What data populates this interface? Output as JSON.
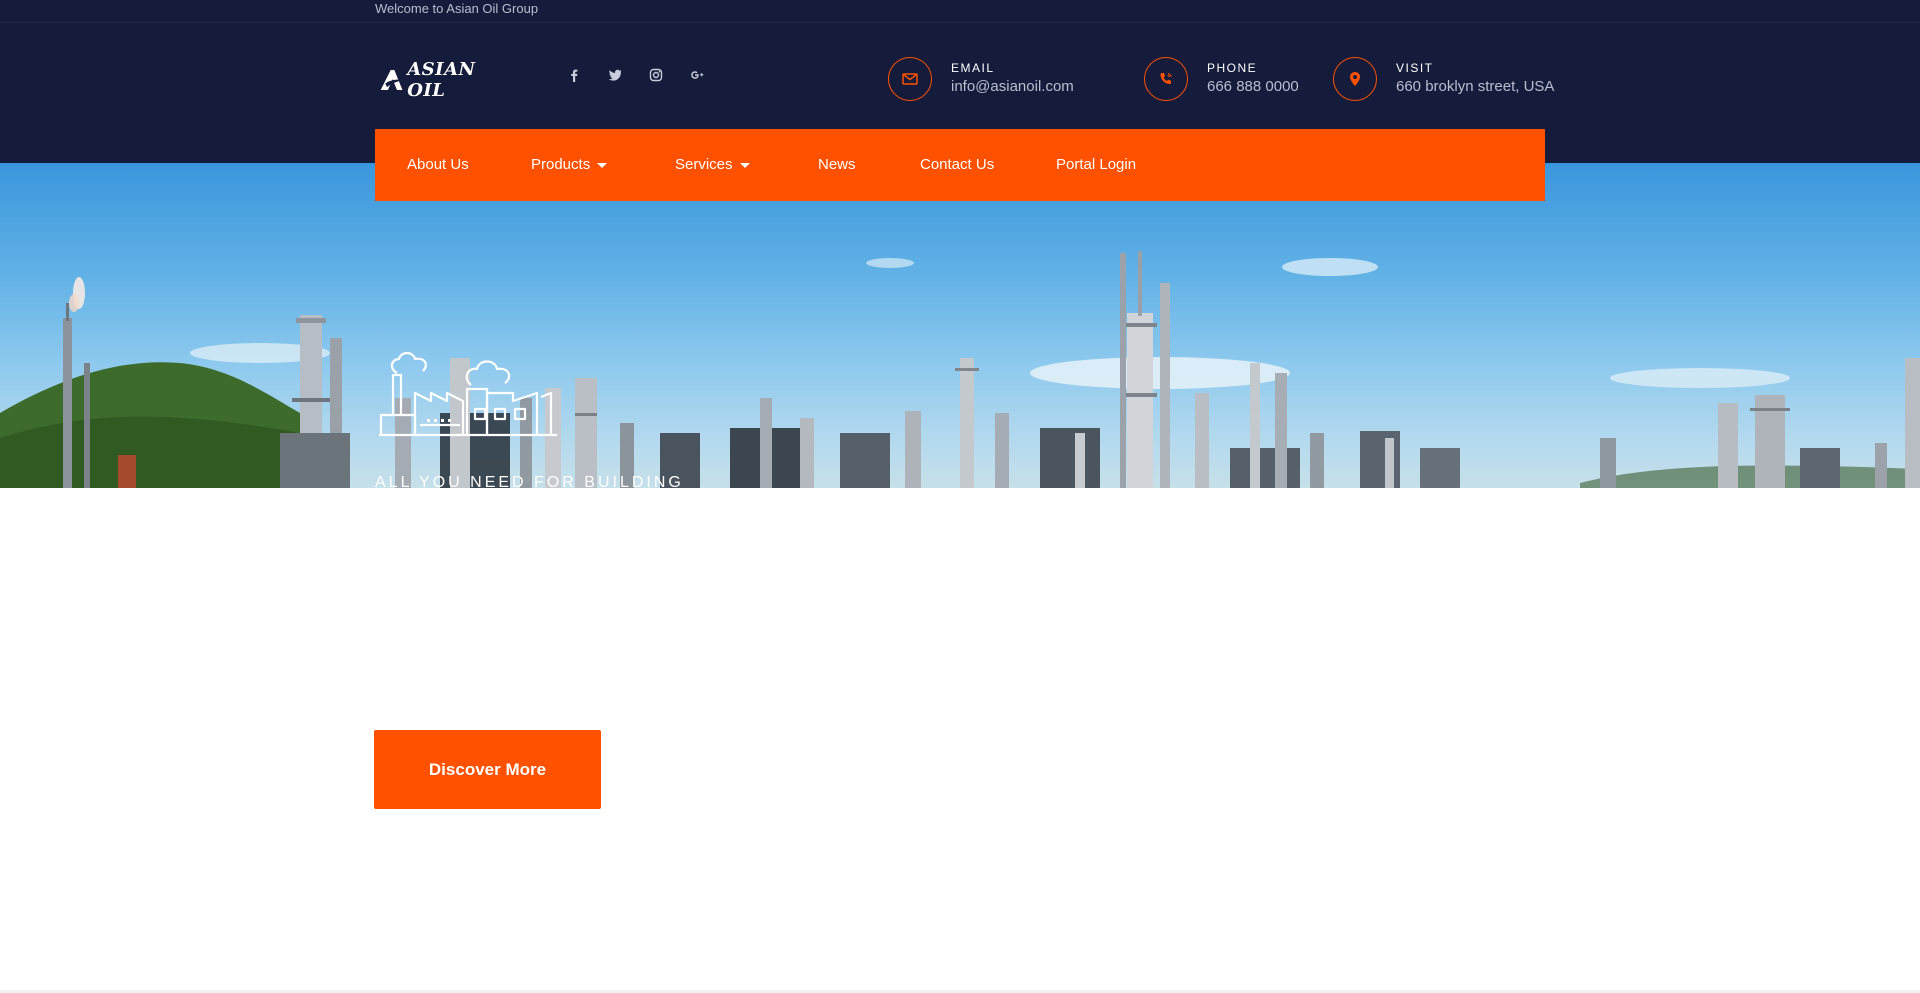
{
  "topbar": {
    "welcome": "Welcome to Asian Oil Group"
  },
  "logo": {
    "text": "ASIAN OIL",
    "color": "#ffffff"
  },
  "social": [
    {
      "name": "facebook-icon"
    },
    {
      "name": "twitter-icon"
    },
    {
      "name": "instagram-icon"
    },
    {
      "name": "google-plus-icon"
    }
  ],
  "contact": {
    "email": {
      "label": "EMAIL",
      "value": "info@asianoil.com",
      "icon": "envelope-icon"
    },
    "phone": {
      "label": "PHONE",
      "value": "666 888 0000",
      "icon": "phone-icon"
    },
    "visit": {
      "label": "VISIT",
      "value": "660 broklyn street, USA",
      "icon": "location-pin-icon"
    }
  },
  "nav": {
    "items": [
      {
        "label": "About Us"
      },
      {
        "label": "Products",
        "dropdown": true
      },
      {
        "label": "Services",
        "dropdown": true
      },
      {
        "label": "News"
      },
      {
        "label": "Contact Us"
      },
      {
        "label": "Portal Login"
      }
    ]
  },
  "hero": {
    "tagline": "ALL YOU NEED FOR BUILDING",
    "icon": "factory-icon"
  },
  "cta": {
    "label": "Discover More"
  },
  "colors": {
    "header_bg": "#151c3b",
    "accent": "#ff5100",
    "muted_text": "#b9bdd0"
  }
}
